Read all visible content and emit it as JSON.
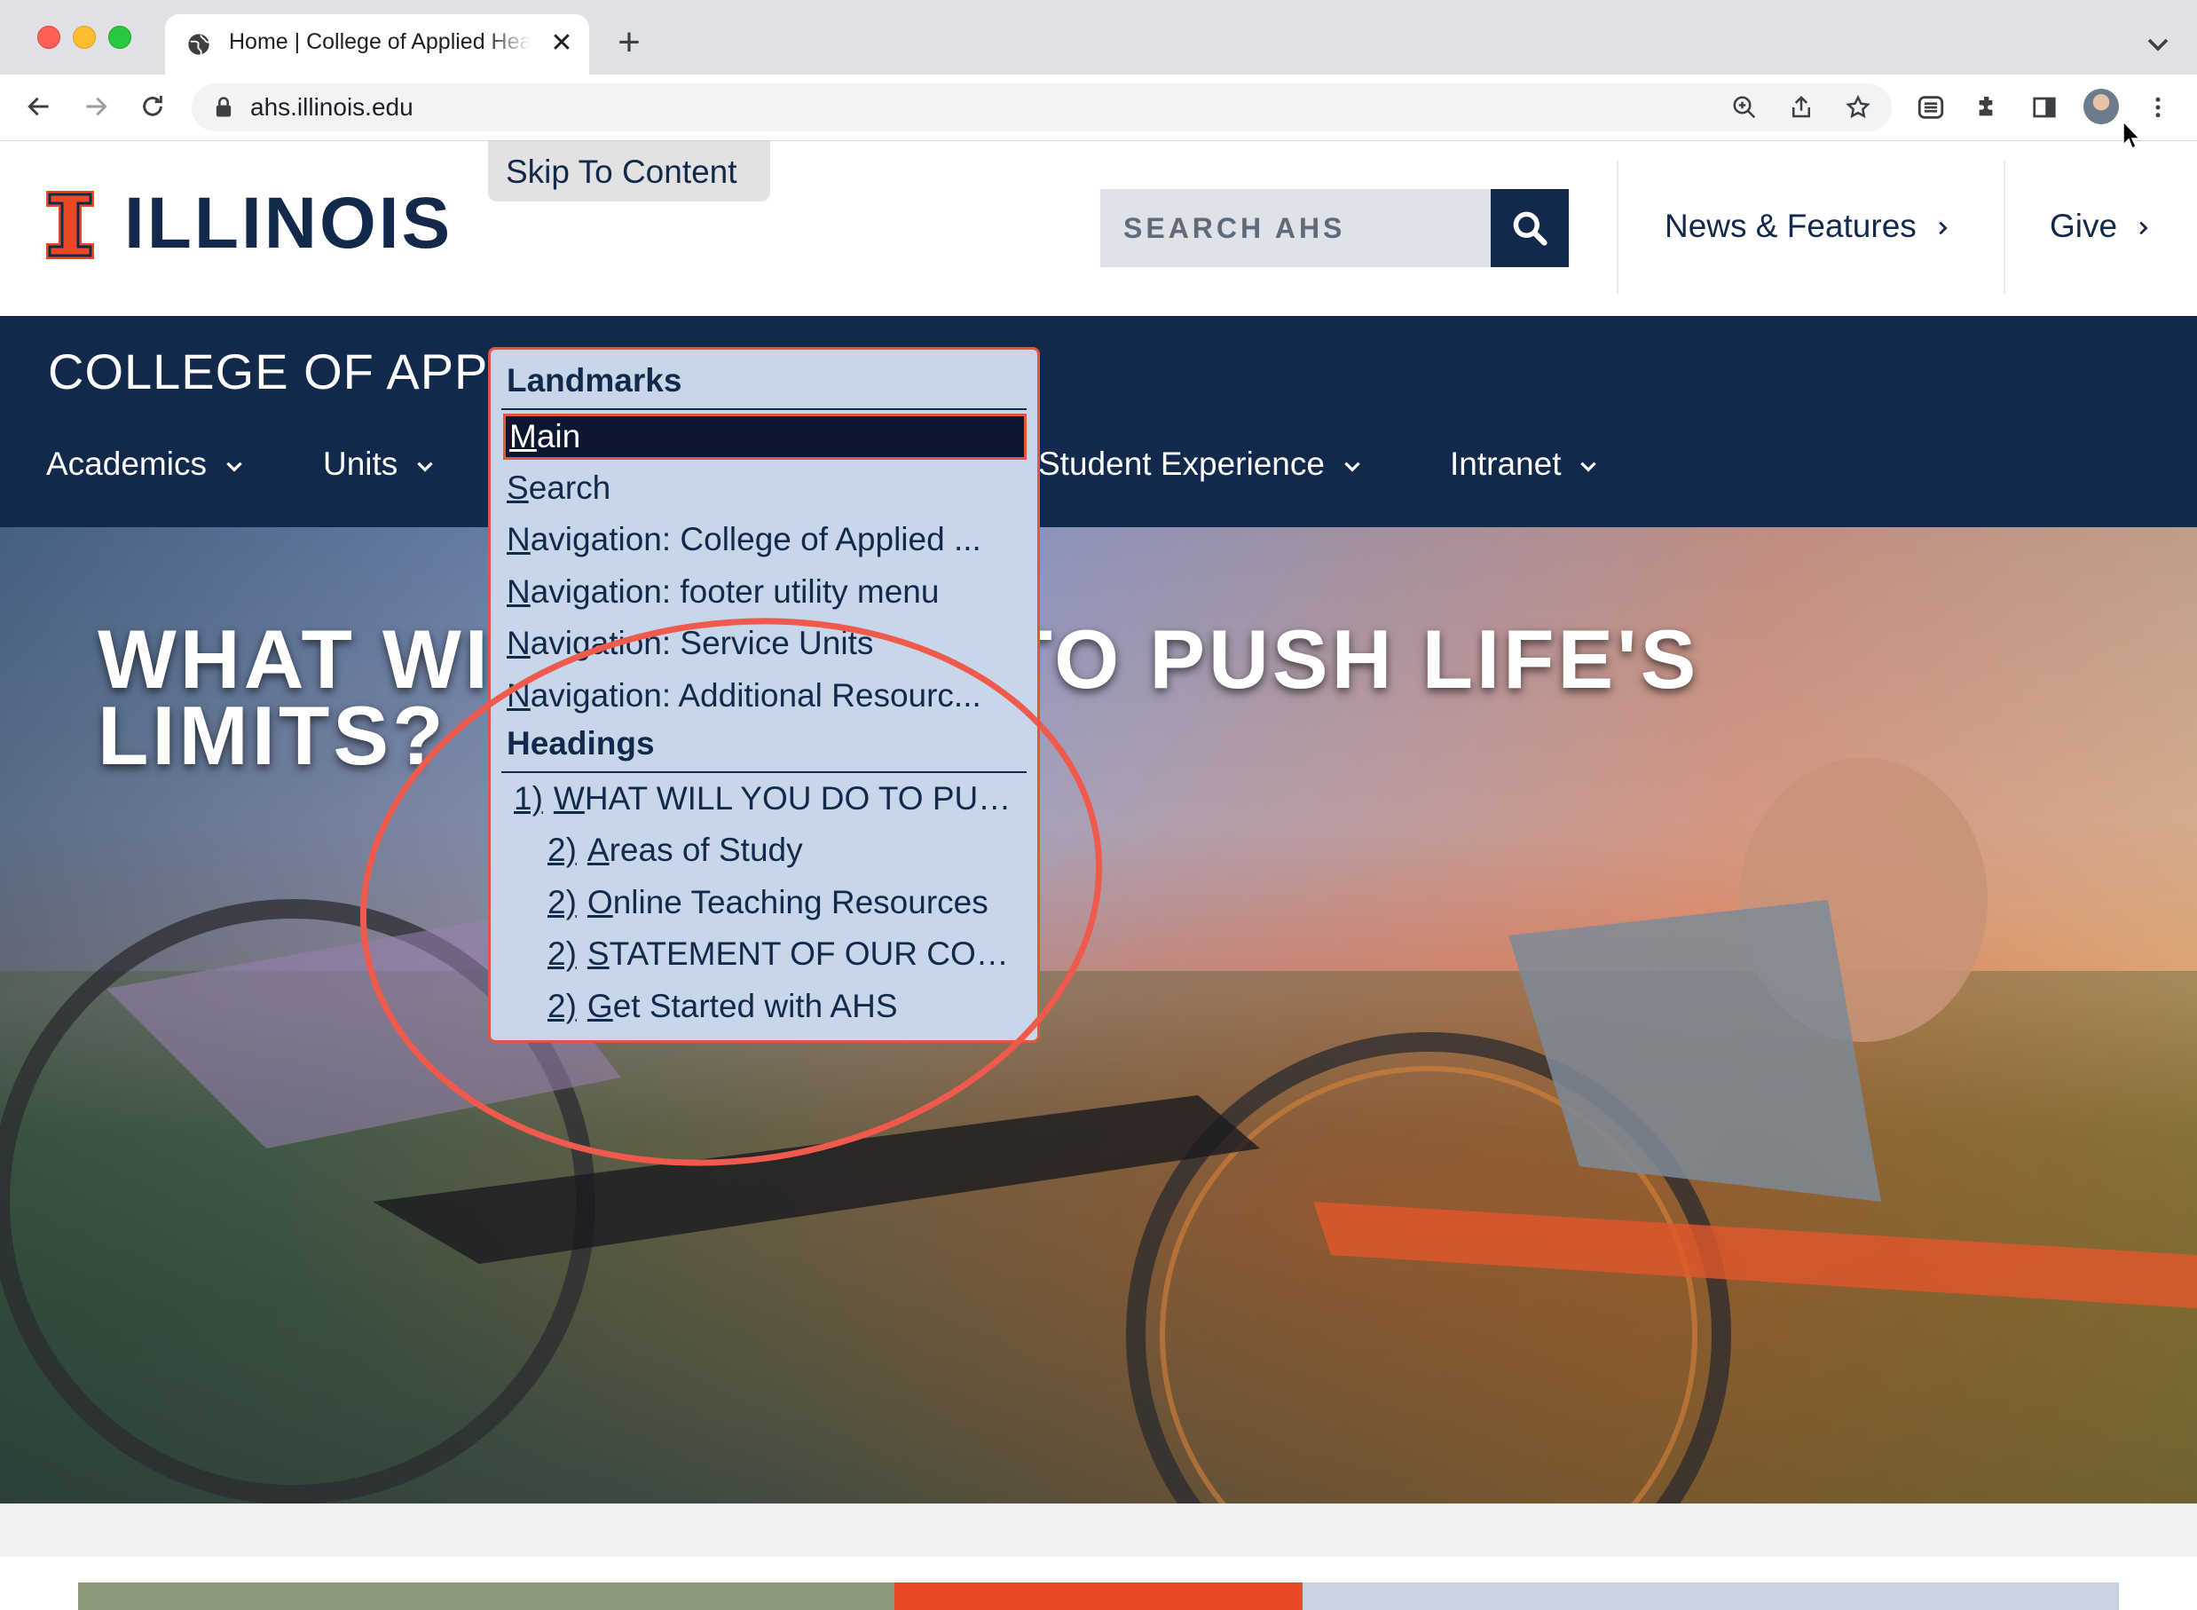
{
  "browser": {
    "tab_title": "Home | College of Applied Health Sciences",
    "tab_close": "✕",
    "new_tab": "+",
    "url": "ahs.illinois.edu"
  },
  "site": {
    "logo_text": "ILLINOIS",
    "skip_to_content": "Skip To Content",
    "search_placeholder": "SEARCH AHS",
    "header_links": [
      "News & Features",
      "Give"
    ],
    "college_title": "COLLEGE OF APPLIED HEALTH SCIENCES",
    "college_title_visible": "COLLEGE OF APPL",
    "nav": [
      "Academics",
      "Units",
      "Student Experience",
      "Intranet"
    ],
    "hero_heading": "WHAT WILL YOU DO TO PUSH LIFE'S LIMITS?"
  },
  "landmarks_popup": {
    "landmarks_heading": "Landmarks",
    "landmarks": [
      {
        "key": "M",
        "rest": "ain"
      },
      {
        "key": "S",
        "rest": "earch"
      },
      {
        "key": "N",
        "rest": "avigation: College of Applied ..."
      },
      {
        "key": "N",
        "rest": "avigation: footer utility menu"
      },
      {
        "key": "N",
        "rest": "avigation: Service Units"
      },
      {
        "key": "N",
        "rest": "avigation: Additional Resourc..."
      }
    ],
    "headings_heading": "Headings",
    "headings": [
      {
        "level": "1)",
        "key": "W",
        "rest": "HAT WILL YOU DO TO PUS..."
      },
      {
        "level": "2)",
        "key": "A",
        "rest": "reas of Study"
      },
      {
        "level": "2)",
        "key": "O",
        "rest": "nline Teaching Resources"
      },
      {
        "level": "2)",
        "key": "S",
        "rest": "TATEMENT OF OUR COM..."
      },
      {
        "level": "2)",
        "key": "G",
        "rest": "et Started with AHS"
      }
    ]
  },
  "colors": {
    "illinois_blue": "#13294b",
    "illinois_orange": "#e84a27",
    "popup_bg": "#c8d6ea",
    "annotation_red": "#f05a4c"
  }
}
